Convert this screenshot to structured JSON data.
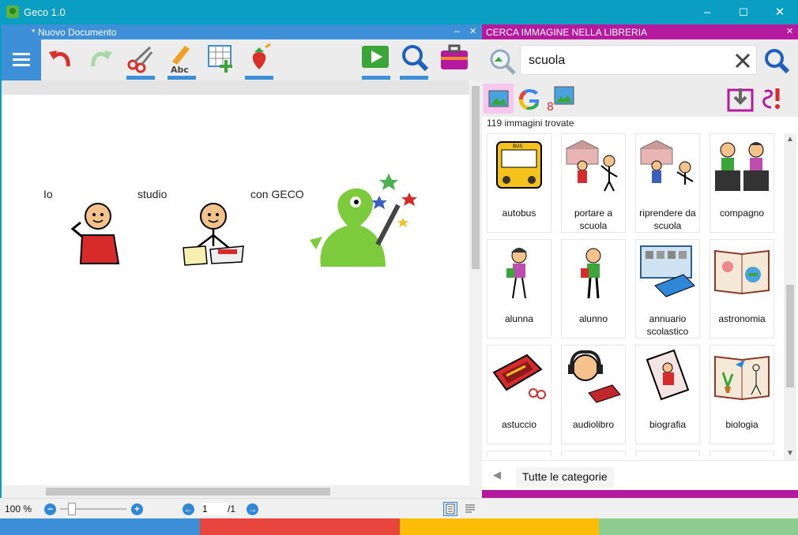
{
  "window": {
    "title": "Geco 1.0",
    "controls": [
      "–",
      "☐",
      "✕"
    ]
  },
  "document": {
    "title": "* Nuovo Documento",
    "minimize": "–",
    "close": "✕",
    "words": [
      {
        "text": "Io"
      },
      {
        "text": "studio"
      },
      {
        "text": "con GECO"
      }
    ]
  },
  "toolbar": {
    "items": [
      "menu",
      "undo",
      "redo",
      "cut",
      "spellcheck",
      "table",
      "paste-image",
      "play",
      "zoom",
      "briefcase"
    ]
  },
  "panel": {
    "title": "CERCA IMMAGINE NELLA LIBRERIA",
    "close": "✕",
    "search": {
      "value": "scuola",
      "placeholder": ""
    },
    "result_count": "119 immagini trovate",
    "results": [
      {
        "label": "autobus",
        "icon": "bus-icon"
      },
      {
        "label": "portare a scuola",
        "icon": "school-drop-icon"
      },
      {
        "label": "riprendere da scuola",
        "icon": "school-pickup-icon"
      },
      {
        "label": "compagno",
        "icon": "classmates-icon"
      },
      {
        "label": "alunna",
        "icon": "girl-pupil-icon"
      },
      {
        "label": "alunno",
        "icon": "boy-pupil-icon"
      },
      {
        "label": "annuario scolastico",
        "icon": "yearbook-icon"
      },
      {
        "label": "astronomia",
        "icon": "astronomy-book-icon"
      },
      {
        "label": "astuccio",
        "icon": "pencil-case-icon"
      },
      {
        "label": "audiolibro",
        "icon": "audiobook-icon"
      },
      {
        "label": "biografia",
        "icon": "biography-icon"
      },
      {
        "label": "biologia",
        "icon": "biology-book-icon"
      }
    ],
    "category": "Tutte le categorie"
  },
  "status": {
    "zoom": "100 %",
    "page_current": "1",
    "page_total": "/1"
  },
  "colors": {
    "titlebar": "#0b9ec3",
    "doc_header": "#3d8fd8",
    "panel_header": "#b51a9e",
    "bar": [
      "#3d8fd8",
      "#e8453c",
      "#fbbc05",
      "#8fcc8f"
    ]
  }
}
